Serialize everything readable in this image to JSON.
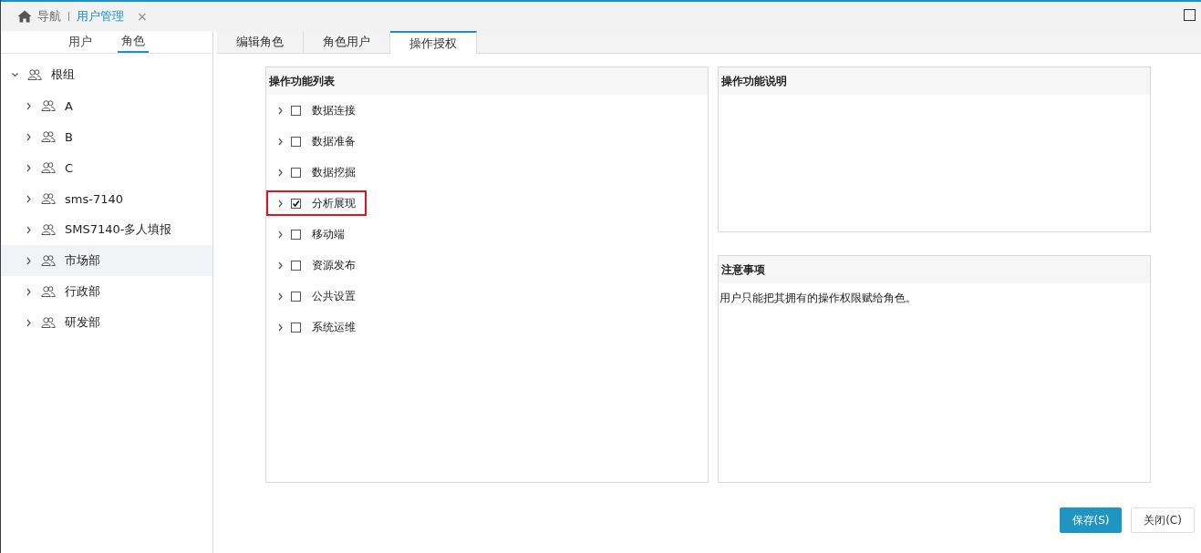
{
  "top_bar": {
    "tabs": [
      {
        "label": "导航",
        "kind": "home",
        "selected": false
      },
      {
        "label": "用户管理",
        "kind": "closable",
        "selected": true
      }
    ],
    "close_mark": "×"
  },
  "sidebar": {
    "tabs": [
      {
        "label": "用户",
        "selected": false
      },
      {
        "label": "角色",
        "selected": true
      }
    ],
    "tree": [
      {
        "label": "根组",
        "expanded": true,
        "selected": false,
        "children": [
          {
            "label": "A",
            "expanded": false,
            "selected": false
          },
          {
            "label": "B",
            "expanded": false,
            "selected": false
          },
          {
            "label": "C",
            "expanded": false,
            "selected": false
          },
          {
            "label": "sms-7140",
            "expanded": false,
            "selected": false
          },
          {
            "label": "SMS7140-多人填报",
            "expanded": false,
            "selected": false
          },
          {
            "label": "市场部",
            "expanded": false,
            "selected": true
          },
          {
            "label": "行政部",
            "expanded": false,
            "selected": false
          },
          {
            "label": "研发部",
            "expanded": false,
            "selected": false
          }
        ]
      }
    ]
  },
  "content_tabs": [
    {
      "label": "编辑角色",
      "selected": false
    },
    {
      "label": "角色用户",
      "selected": false
    },
    {
      "label": "操作授权",
      "selected": true
    }
  ],
  "function_list": {
    "title": "操作功能列表",
    "items": [
      {
        "label": "数据连接",
        "checked": false,
        "highlighted": false
      },
      {
        "label": "数据准备",
        "checked": false,
        "highlighted": false
      },
      {
        "label": "数据挖掘",
        "checked": false,
        "highlighted": false
      },
      {
        "label": "分析展现",
        "checked": true,
        "highlighted": true
      },
      {
        "label": "移动端",
        "checked": false,
        "highlighted": false
      },
      {
        "label": "资源发布",
        "checked": false,
        "highlighted": false
      },
      {
        "label": "公共设置",
        "checked": false,
        "highlighted": false
      },
      {
        "label": "系统运维",
        "checked": false,
        "highlighted": false
      }
    ]
  },
  "description_panel": {
    "title": "操作功能说明"
  },
  "notes_panel": {
    "title": "注意事项",
    "text": "用户只能把其拥有的操作权限赋给角色。"
  },
  "buttons": [
    {
      "label": "保存(S)",
      "kind": "primary"
    },
    {
      "label": "关闭(C)",
      "kind": "secondary"
    }
  ]
}
